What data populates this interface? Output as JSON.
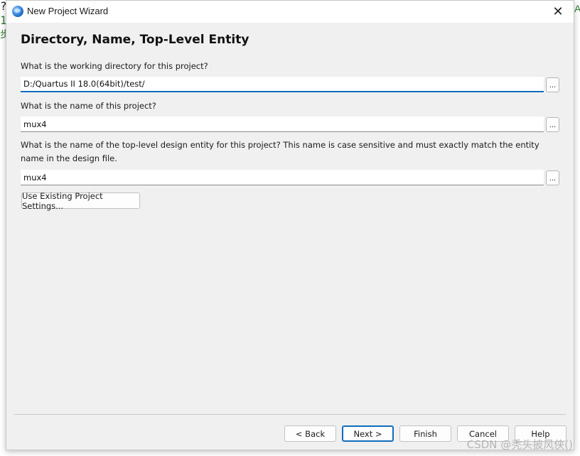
{
  "background": {
    "left_chars": [
      "?",
      "1",
      "步"
    ],
    "right_char": "A"
  },
  "window": {
    "title": "New Project Wizard",
    "close_glyph": "✕"
  },
  "page": {
    "heading": "Directory, Name, Top-Level Entity",
    "directory_label": "What is the working directory for this project?",
    "directory_value": "D:/Quartus II 18.0(64bit)/test/",
    "name_label": "What is the name of this project?",
    "name_value": "mux4",
    "entity_label": "What is the name of the top-level design entity for this project? This name is case sensitive and must exactly match the entity name in the design file.",
    "entity_value": "mux4",
    "browse_label": "...",
    "existing_settings_button": "Use Existing Project Settings..."
  },
  "footer": {
    "back": "< Back",
    "next": "Next >",
    "finish": "Finish",
    "cancel": "Cancel",
    "help": "Help"
  },
  "watermark": "CSDN @秃头披风侠()"
}
